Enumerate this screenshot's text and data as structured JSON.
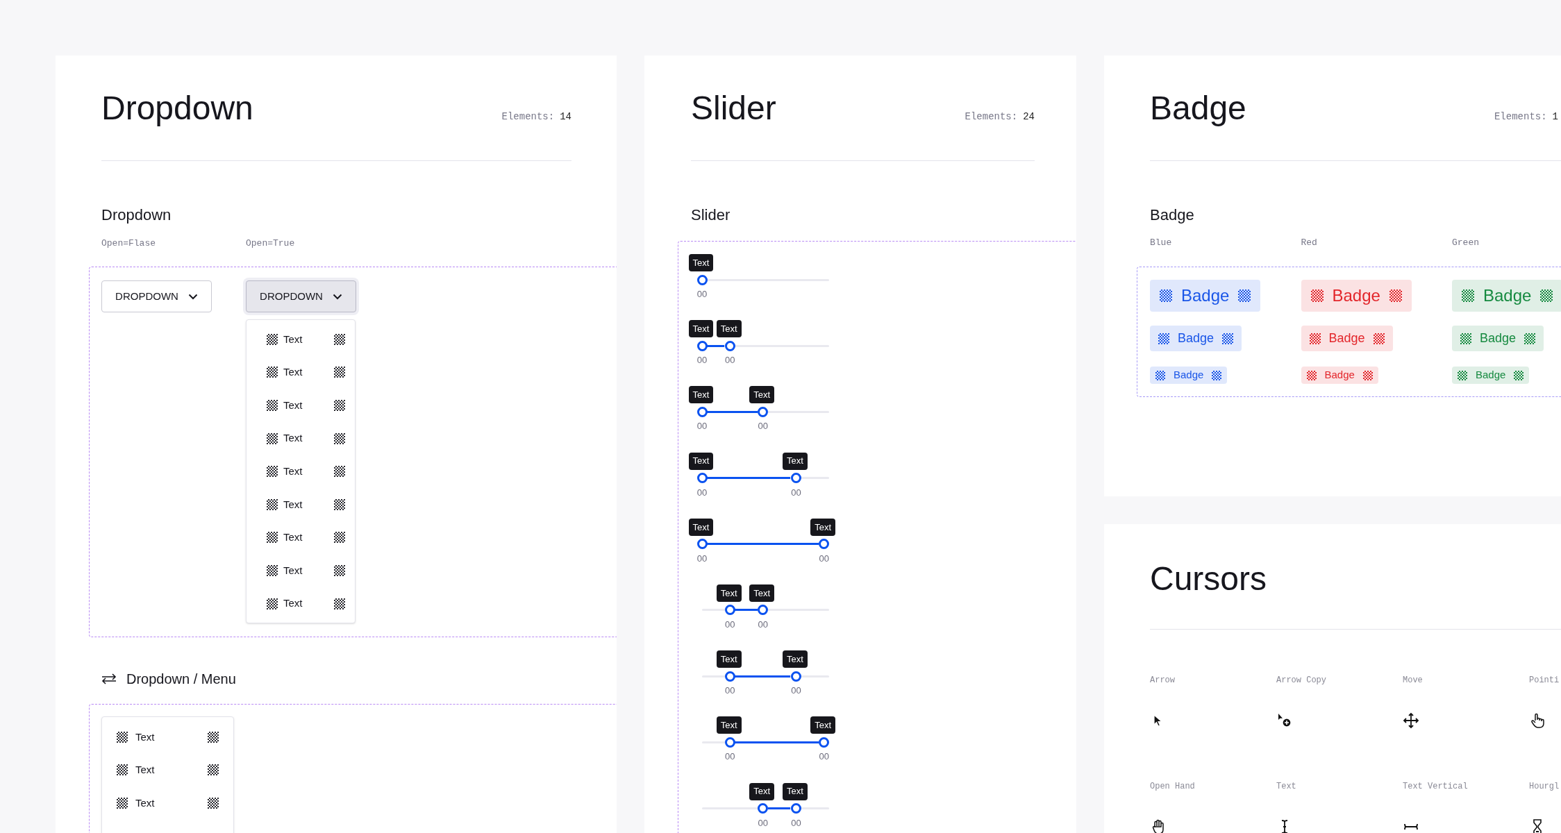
{
  "dropdown_card": {
    "title": "Dropdown",
    "elements_label": "Elements:",
    "elements_count": "14",
    "section_title": "Dropdown",
    "variants": [
      {
        "label": "Open=Flase",
        "button": "DROPDOWN",
        "open": false
      },
      {
        "label": "Open=True",
        "button": "DROPDOWN",
        "open": true,
        "items": [
          "Text",
          "Text",
          "Text",
          "Text",
          "Text",
          "Text",
          "Text",
          "Text",
          "Text"
        ]
      }
    ],
    "menu_section": {
      "title": "Dropdown / Menu",
      "items": [
        "Text",
        "Text",
        "Text"
      ]
    }
  },
  "slider_card": {
    "title": "Slider",
    "elements_label": "Elements:",
    "elements_count": "24",
    "section_title": "Slider",
    "rows": [
      {
        "thumbs": [
          {
            "level": 0,
            "tooltip": "Text",
            "value": "00"
          }
        ]
      },
      {
        "thumbs": [
          {
            "level": 0,
            "tooltip": "Text",
            "value": "00"
          },
          {
            "level": 0.22,
            "tooltip": "Text",
            "value": "00"
          }
        ]
      },
      {
        "thumbs": [
          {
            "level": 0,
            "tooltip": "Text",
            "value": "00"
          },
          {
            "level": 0.48,
            "tooltip": "Text",
            "value": "00"
          }
        ]
      },
      {
        "thumbs": [
          {
            "level": 0,
            "tooltip": "Text",
            "value": "00"
          },
          {
            "level": 0.74,
            "tooltip": "Text",
            "value": "00"
          }
        ]
      },
      {
        "thumbs": [
          {
            "level": 0,
            "tooltip": "Text",
            "value": "00"
          },
          {
            "level": 0.96,
            "tooltip": "Text",
            "value": "00"
          }
        ]
      },
      {
        "thumbs": [
          {
            "level": 0.22,
            "tooltip": "Text",
            "value": "00"
          },
          {
            "level": 0.48,
            "tooltip": "Text",
            "value": "00"
          }
        ]
      },
      {
        "thumbs": [
          {
            "level": 0.22,
            "tooltip": "Text",
            "value": "00"
          },
          {
            "level": 0.74,
            "tooltip": "Text",
            "value": "00"
          }
        ]
      },
      {
        "thumbs": [
          {
            "level": 0.22,
            "tooltip": "Text",
            "value": "00"
          },
          {
            "level": 0.96,
            "tooltip": "Text",
            "value": "00"
          }
        ]
      },
      {
        "thumbs": [
          {
            "level": 0.48,
            "tooltip": "Text",
            "value": "00"
          },
          {
            "level": 0.74,
            "tooltip": "Text",
            "value": "00"
          }
        ]
      }
    ]
  },
  "badge_card": {
    "title": "Badge",
    "elements_label": "Elements:",
    "elements_count": "1",
    "section_title": "Badge",
    "columns": [
      {
        "label": "Blue",
        "color": "#1a56e8",
        "badges": [
          {
            "kind": "large",
            "text": "Badge"
          },
          {
            "kind": "medium",
            "text": "Badge"
          },
          {
            "kind": "small",
            "text": "Badge"
          }
        ]
      },
      {
        "label": "Red",
        "color": "#e3262b",
        "badges": [
          {
            "kind": "large",
            "text": "Badge"
          },
          {
            "kind": "medium",
            "text": "Badge"
          },
          {
            "kind": "small",
            "text": "Badge"
          }
        ]
      },
      {
        "label": "Green",
        "color": "#168a40",
        "badges": [
          {
            "kind": "large",
            "text": "Badge"
          },
          {
            "kind": "medium",
            "text": "Badge"
          },
          {
            "kind": "small",
            "text": "Badge"
          }
        ]
      }
    ]
  },
  "cursors_card": {
    "title": "Cursors",
    "items": [
      {
        "label": "Arrow",
        "kind": "arrow"
      },
      {
        "label": "Arrow Copy",
        "kind": "arrow_copy"
      },
      {
        "label": "Move",
        "kind": "move"
      },
      {
        "label": "Pointi",
        "kind": "pointer"
      },
      {
        "label": "Open Hand",
        "kind": "open_hand"
      },
      {
        "label": "Text",
        "kind": "text"
      },
      {
        "label": "Text Vertical",
        "kind": "text_vertical"
      },
      {
        "label": "Hourgl",
        "kind": "hourglass"
      }
    ]
  }
}
